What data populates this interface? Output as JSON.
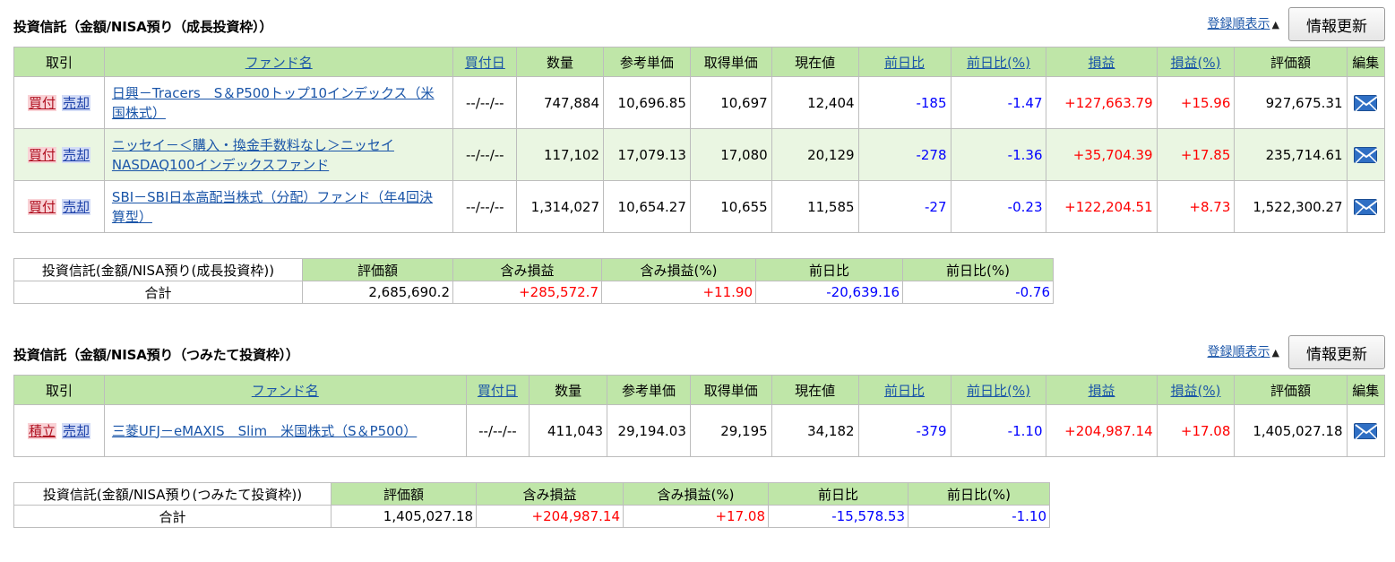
{
  "growth": {
    "title": "投資信託（金額/NISA預り（成長投資枠））",
    "sort_link": "登録順表示",
    "sort_icon": "▲",
    "refresh_label": "情報更新",
    "columns": {
      "action": "取引",
      "fund": "ファンド名",
      "buy_date": "買付日",
      "quantity": "数量",
      "ref_price": "参考単価",
      "cost_price": "取得単価",
      "current_price": "現在値",
      "day_change": "前日比",
      "day_change_pct": "前日比(%)",
      "pnl": "損益",
      "pnl_pct": "損益(%)",
      "valuation": "評価額",
      "edit": "編集"
    },
    "rows": [
      {
        "buy": "買付",
        "sell": "売却",
        "fund": "日興－Tracers　S＆P500トップ10インデックス（米国株式）",
        "buy_date": "--/--/--",
        "quantity": "747,884",
        "ref_price": "10,696.85",
        "cost_price": "10,697",
        "current_price": "12,404",
        "day_change": "-185",
        "day_change_pct": "-1.47",
        "pnl": "+127,663.79",
        "pnl_pct": "+15.96",
        "valuation": "927,675.31",
        "edit_icon": "mail-icon"
      },
      {
        "buy": "買付",
        "sell": "売却",
        "fund": "ニッセイ－＜購入・換金手数料なし＞ニッセイNASDAQ100インデックスファンド",
        "buy_date": "--/--/--",
        "quantity": "117,102",
        "ref_price": "17,079.13",
        "cost_price": "17,080",
        "current_price": "20,129",
        "day_change": "-278",
        "day_change_pct": "-1.36",
        "pnl": "+35,704.39",
        "pnl_pct": "+17.85",
        "valuation": "235,714.61",
        "edit_icon": "mail-icon"
      },
      {
        "buy": "買付",
        "sell": "売却",
        "fund": "SBI－SBI日本高配当株式（分配）ファンド（年4回決算型）",
        "buy_date": "--/--/--",
        "quantity": "1,314,027",
        "ref_price": "10,654.27",
        "cost_price": "10,655",
        "current_price": "11,585",
        "day_change": "-27",
        "day_change_pct": "-0.23",
        "pnl": "+122,204.51",
        "pnl_pct": "+8.73",
        "valuation": "1,522,300.27",
        "edit_icon": "mail-icon"
      }
    ],
    "summary": {
      "label": "投資信託(金額/NISA預り(成長投資枠))",
      "total_label": "合計",
      "headers": {
        "valuation": "評価額",
        "unrealized": "含み損益",
        "unrealized_pct": "含み損益(%)",
        "day_change": "前日比",
        "day_change_pct": "前日比(%)"
      },
      "values": {
        "valuation": "2,685,690.2",
        "unrealized": "+285,572.7",
        "unrealized_pct": "+11.90",
        "day_change": "-20,639.16",
        "day_change_pct": "-0.76"
      }
    }
  },
  "tsumitate": {
    "title": "投資信託（金額/NISA預り（つみたて投資枠））",
    "sort_link": "登録順表示",
    "sort_icon": "▲",
    "refresh_label": "情報更新",
    "columns": {
      "action": "取引",
      "fund": "ファンド名",
      "buy_date": "買付日",
      "quantity": "数量",
      "ref_price": "参考単価",
      "cost_price": "取得単価",
      "current_price": "現在値",
      "day_change": "前日比",
      "day_change_pct": "前日比(%)",
      "pnl": "損益",
      "pnl_pct": "損益(%)",
      "valuation": "評価額",
      "edit": "編集"
    },
    "rows": [
      {
        "buy": "積立",
        "sell": "売却",
        "fund": "三菱UFJ－eMAXIS　Slim　米国株式（S＆P500）",
        "buy_date": "--/--/--",
        "quantity": "411,043",
        "ref_price": "29,194.03",
        "cost_price": "29,195",
        "current_price": "34,182",
        "day_change": "-379",
        "day_change_pct": "-1.10",
        "pnl": "+204,987.14",
        "pnl_pct": "+17.08",
        "valuation": "1,405,027.18",
        "edit_icon": "mail-icon"
      }
    ],
    "summary": {
      "label": "投資信託(金額/NISA預り(つみたて投資枠))",
      "total_label": "合計",
      "headers": {
        "valuation": "評価額",
        "unrealized": "含み損益",
        "unrealized_pct": "含み損益(%)",
        "day_change": "前日比",
        "day_change_pct": "前日比(%)"
      },
      "values": {
        "valuation": "1,405,027.18",
        "unrealized": "+204,987.14",
        "unrealized_pct": "+17.08",
        "day_change": "-15,578.53",
        "day_change_pct": "-1.10"
      }
    }
  }
}
